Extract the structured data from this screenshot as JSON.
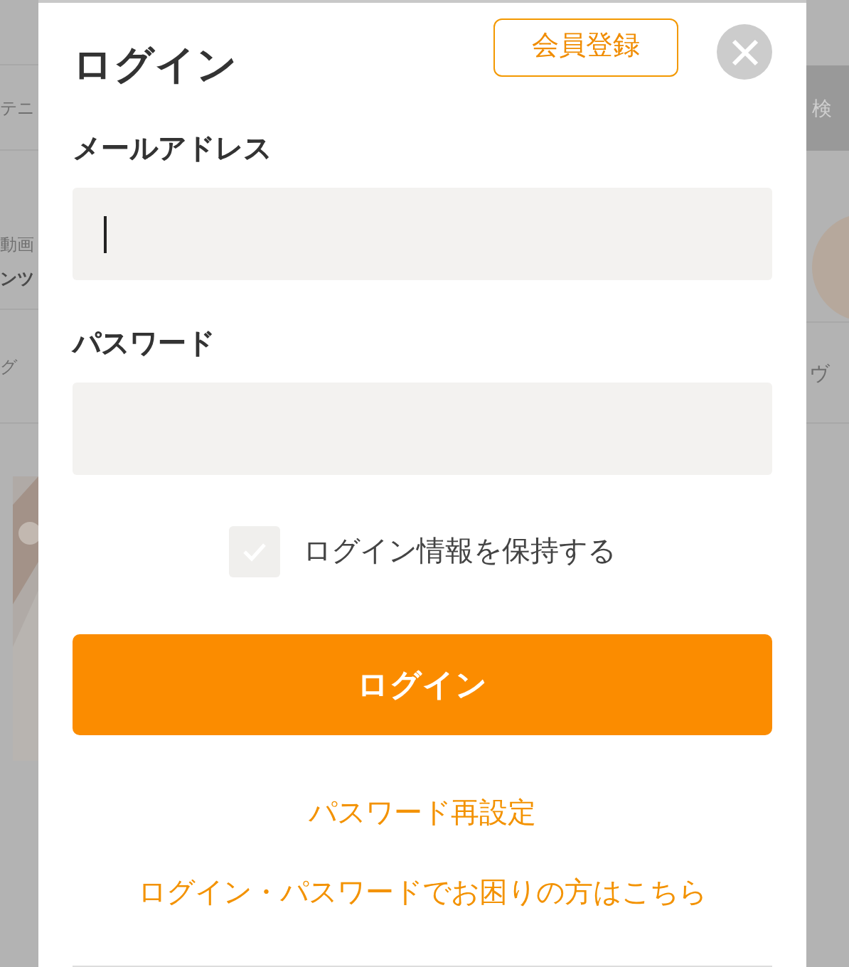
{
  "background": {
    "left_texts": [
      "テニ",
      "動画",
      "ンツ",
      "グ"
    ],
    "right_texts": [
      "検",
      "ヴ"
    ]
  },
  "dialog": {
    "title": "ログイン",
    "register_button": "会員登録",
    "fields": [
      {
        "label": "メールアドレス",
        "focused": true
      },
      {
        "label": "パスワード",
        "focused": false
      }
    ],
    "remember": {
      "label": "ログイン情報を保持する",
      "checked": false
    },
    "submit": "ログイン",
    "links": [
      "パスワード再設定",
      "ログイン・パスワードでお困りの方はこちら"
    ]
  }
}
